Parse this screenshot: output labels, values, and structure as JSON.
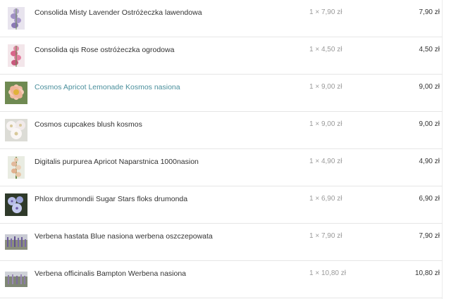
{
  "cart": {
    "items": [
      {
        "name": "Consolida Misty Lavender Ostróżeczka lawendowa",
        "qty": "1 × 7,90 zł",
        "total": "7,90 zł",
        "link": false,
        "icon": "lavender-flower-thumbnail"
      },
      {
        "name": "Consolida qis Rose ostróżeczka ogrodowa",
        "qty": "1 × 4,50 zł",
        "total": "4,50 zł",
        "link": false,
        "icon": "pink-flower-thumbnail"
      },
      {
        "name": "Cosmos Apricot Lemonade Kosmos nasiona",
        "qty": "1 × 9,00 zł",
        "total": "9,00 zł",
        "link": true,
        "icon": "apricot-cosmos-thumbnail"
      },
      {
        "name": "Cosmos cupcakes blush kosmos",
        "qty": "1 × 9,00 zł",
        "total": "9,00 zł",
        "link": false,
        "icon": "white-cosmos-thumbnail"
      },
      {
        "name": "Digitalis purpurea Apricot Naparstnica 1000nasion",
        "qty": "1 × 4,90 zł",
        "total": "4,90 zł",
        "link": false,
        "icon": "foxglove-thumbnail"
      },
      {
        "name": "Phlox drummondii Sugar Stars floks drumonda",
        "qty": "1 × 6,90 zł",
        "total": "6,90 zł",
        "link": false,
        "icon": "phlox-thumbnail"
      },
      {
        "name": "Verbena hastata Blue nasiona werbena oszczepowata",
        "qty": "1 × 7,90 zł",
        "total": "7,90 zł",
        "link": false,
        "icon": "verbena-blue-thumbnail"
      },
      {
        "name": "Verbena officinalis Bampton Werbena nasiona",
        "qty": "1 × 10,80 zł",
        "total": "10,80 zł",
        "link": false,
        "icon": "verbena-bampton-thumbnail"
      }
    ]
  },
  "colors": {
    "link": "#4a8f9c",
    "text": "#333333",
    "muted": "#9a9a9a",
    "divider": "#e6e6e6"
  }
}
